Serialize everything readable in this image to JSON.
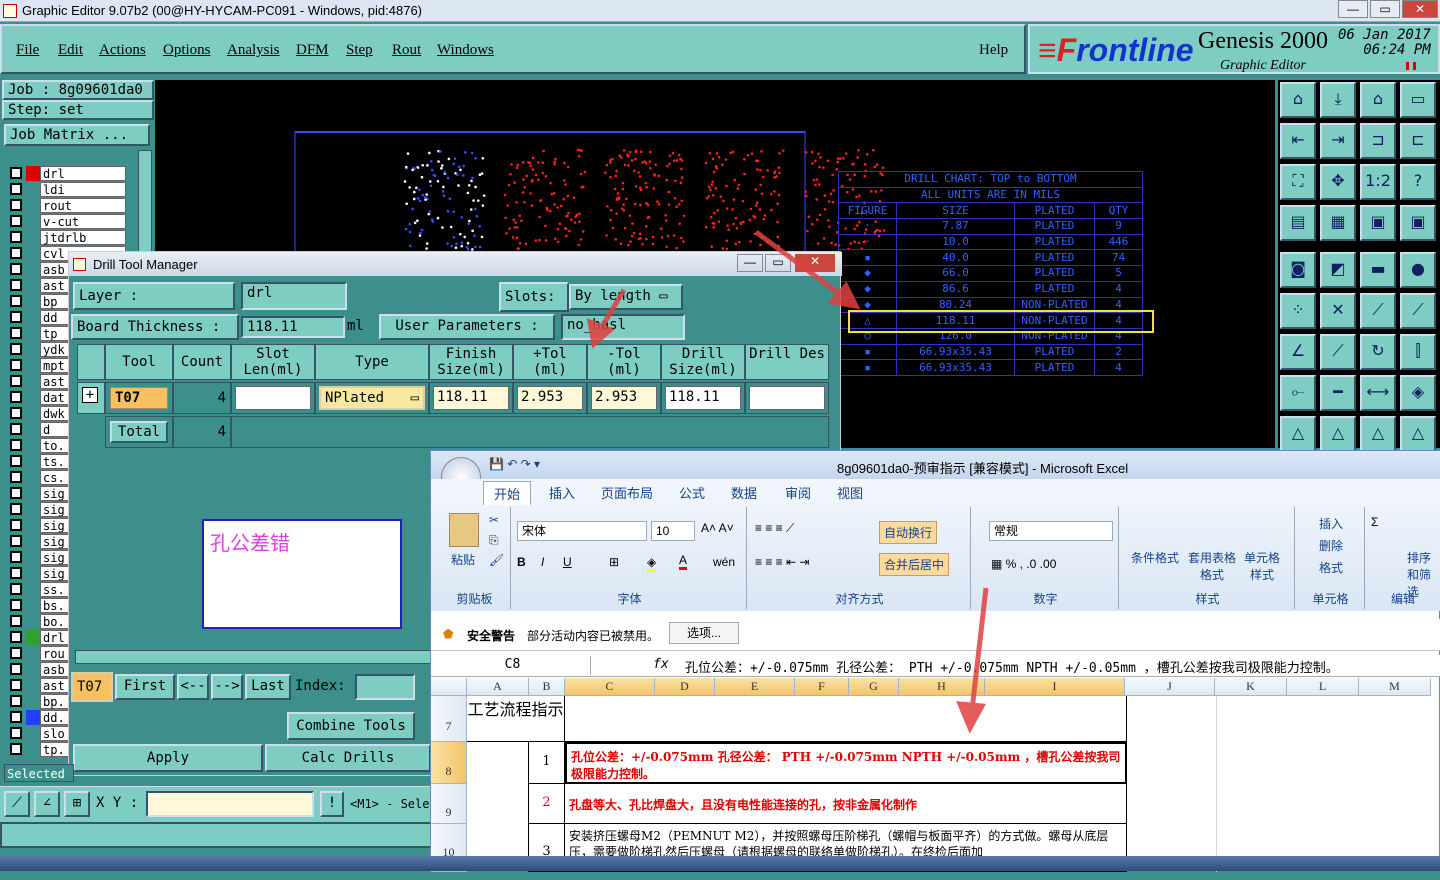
{
  "window": {
    "title": "Graphic Editor 9.07b2 (00@HY-HYCAM-PC091 - Windows, pid:4876)",
    "min": "—",
    "max": "▭",
    "close": "✕"
  },
  "menu": {
    "items": [
      "File",
      "Edit",
      "Actions",
      "Options",
      "Analysis",
      "DFM",
      "Step",
      "Rout",
      "Windows"
    ],
    "help": "Help"
  },
  "logo": {
    "brand_a": "≡F",
    "brand_b": "rontline",
    "product": "Genesis 2000",
    "subtitle": "Graphic Editor",
    "date": "06 Jan 2017",
    "time": "06:24 PM"
  },
  "job": {
    "job_label": "Job : 8g09601da0",
    "step_label": "Step: set",
    "matrix_button": "Job Matrix ..."
  },
  "layers": [
    {
      "name": "drl",
      "color": "#e00000"
    },
    {
      "name": "ldi",
      "color": ""
    },
    {
      "name": "rout",
      "color": ""
    },
    {
      "name": "v-cut",
      "color": ""
    },
    {
      "name": "jtdrlb",
      "color": ""
    },
    {
      "name": "cvl",
      "color": ""
    },
    {
      "name": "asb",
      "color": ""
    },
    {
      "name": "ast",
      "color": ""
    },
    {
      "name": "bp",
      "color": ""
    },
    {
      "name": "dd",
      "color": ""
    },
    {
      "name": "tp",
      "color": ""
    },
    {
      "name": "ydk",
      "color": ""
    },
    {
      "name": "mpt",
      "color": ""
    },
    {
      "name": "ast",
      "color": ""
    },
    {
      "name": "dat",
      "color": ""
    },
    {
      "name": "dwk",
      "color": ""
    },
    {
      "name": "d",
      "color": ""
    },
    {
      "name": "to.",
      "color": ""
    },
    {
      "name": "ts.",
      "color": ""
    },
    {
      "name": "cs.",
      "color": ""
    },
    {
      "name": "sig",
      "color": ""
    },
    {
      "name": "sig",
      "color": ""
    },
    {
      "name": "sig",
      "color": ""
    },
    {
      "name": "sig",
      "color": ""
    },
    {
      "name": "sig",
      "color": ""
    },
    {
      "name": "sig",
      "color": ""
    },
    {
      "name": "ss.",
      "color": ""
    },
    {
      "name": "bs.",
      "color": ""
    },
    {
      "name": "bo.",
      "color": ""
    },
    {
      "name": "drl",
      "color": "#30a030"
    },
    {
      "name": "rou",
      "color": ""
    },
    {
      "name": "asb",
      "color": ""
    },
    {
      "name": "ast",
      "color": ""
    },
    {
      "name": "bp.",
      "color": ""
    },
    {
      "name": "dd.",
      "color": "#2040ff"
    },
    {
      "name": "slo",
      "color": ""
    },
    {
      "name": "tp.",
      "color": ""
    }
  ],
  "status": {
    "selected": "Selected",
    "xy_label": "X Y :",
    "mode": "<M1> - Sele"
  },
  "drill_tool_manager": {
    "title": "Drill Tool Manager",
    "layer_label": "Layer :",
    "layer_value": "drl",
    "slots_label": "Slots:",
    "slots_value": "By length",
    "thickness_label": "Board Thickness :",
    "thickness_value": "118.11",
    "thickness_unit": "ml",
    "user_params_label": "User Parameters :",
    "user_params_value": "no_hasl",
    "columns": [
      "Tool",
      "Count",
      "Slot Len(ml)",
      "Type",
      "Finish Size(ml)",
      "+Tol (ml)",
      "-Tol (ml)",
      "Drill Size(ml)",
      "Drill Des"
    ],
    "row": {
      "tool": "T07",
      "count": "4",
      "slot_len": "",
      "type": "NPlated",
      "finish": "118.11",
      "ptol": "2.953",
      "ntol": "2.953",
      "drill": "118.11",
      "des": ""
    },
    "total_label": "Total",
    "total_count": "4",
    "note": "孔公差错",
    "nav": {
      "tool": "T07",
      "first": "First",
      "prev": "<--",
      "next": "-->",
      "last": "Last",
      "index_label": "Index:"
    },
    "combine": "Combine Tools",
    "apply": "Apply",
    "calc": "Calc Drills"
  },
  "drill_chart": {
    "title1": "DRILL CHART: TOP to BOTTOM",
    "title2": "ALL UNITS ARE IN MILS",
    "header": [
      "FIGURE",
      "SIZE",
      "PLATED",
      "QTY"
    ],
    "rows": [
      [
        "·",
        "7.87",
        "PLATED",
        "9"
      ],
      [
        "·",
        "10.0",
        "PLATED",
        "446"
      ],
      [
        "▪",
        "40.0",
        "PLATED",
        "74"
      ],
      [
        "◆",
        "66.0",
        "PLATED",
        "5"
      ],
      [
        "◆",
        "86.6",
        "PLATED",
        "4"
      ],
      [
        "◆",
        "80.24",
        "NON-PLATED",
        "4"
      ],
      [
        "△",
        "118.11",
        "NON-PLATED",
        "4"
      ],
      [
        "○",
        "126.0",
        "NON-PLATED",
        "4"
      ],
      [
        "▪",
        "66.93x35.43",
        "PLATED",
        "2"
      ],
      [
        "▪",
        "66.93x35.43",
        "PLATED",
        "4"
      ]
    ]
  },
  "excel": {
    "title": "8g09601da0-预审指示 [兼容模式] - Microsoft Excel",
    "tabs": [
      "开始",
      "插入",
      "页面布局",
      "公式",
      "数据",
      "审阅",
      "视图"
    ],
    "font_name": "宋体",
    "font_size": "10",
    "groups": {
      "clipboard": "剪贴板",
      "font": "字体",
      "align": "对齐方式",
      "number": "数字",
      "styles": "样式",
      "cells": "单元格",
      "edit": "编辑"
    },
    "buttons": {
      "paste": "粘贴",
      "wrap": "自动换行",
      "merge": "合并后居中",
      "number_format": "常规",
      "cond": "条件格式",
      "table": "套用表格格式",
      "cellstyle": "单元格样式",
      "insert": "插入",
      "delete": "删除",
      "format": "格式",
      "sort": "排序和筛选"
    },
    "security_title": "安全警告",
    "security_msg": "部分活动内容已被禁用。",
    "options": "选项...",
    "namebox": "C8",
    "formula": "孔位公差：+/-0.075mm  孔径公差： PTH +/-0.075mm NPTH +/-0.05mm ，槽孔公差按我司极限能力控制。",
    "columns": [
      "A",
      "B",
      "C",
      "D",
      "E",
      "F",
      "G",
      "H",
      "I",
      "J",
      "K",
      "L",
      "M"
    ],
    "rows": {
      "r7": "7",
      "r8": "8",
      "r9": "9",
      "r10": "10",
      "header_cell": "工艺流程指示",
      "n1": "1",
      "n2": "2",
      "n3": "3",
      "t1": "孔位公差：+/-0.075mm  孔径公差： PTH +/-0.075mm NPTH +/-0.05mm ，槽孔公差按我司极限能力控制。",
      "t2": "孔盘等大、孔比焊盘大，且没有电性能连接的孔，按非金属化制作",
      "t3": "安装挤压螺母M2（PEMNUT M2），并按照螺母压阶梯孔（螺帽与板面平齐）的方式做。螺母从底层压，需要做阶梯孔然后压螺母（请根据螺母的联络单做阶梯孔）。在终检后面加"
    }
  }
}
